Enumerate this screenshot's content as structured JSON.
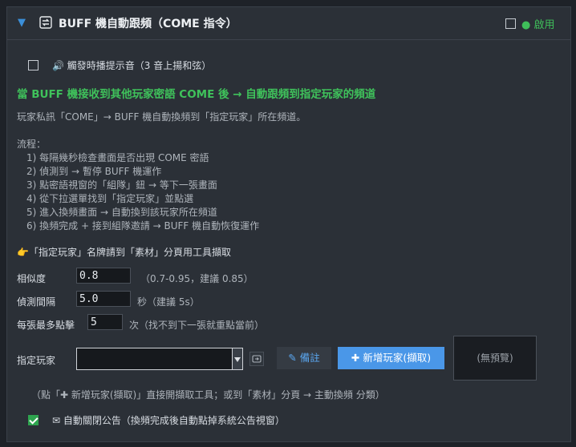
{
  "header": {
    "title": "BUFF 機自動跟頻（COME 指令）",
    "enable_label": "● 啟用"
  },
  "sound_option": {
    "label": "🔊 觸發時播提示音（3 音上揚和弦）",
    "checked": false
  },
  "headline": "當 BUFF 機接收到其他玩家密語 COME 後 → 自動跟頻到指定玩家的頻道",
  "description": "玩家私訊「COME」→ BUFF 機自動換頻到「指定玩家」所在頻道。",
  "flow": {
    "title": "流程：",
    "steps": [
      "1) 每隔幾秒檢查畫面是否出現 COME 密語",
      "2) 偵測到 → 暫停 BUFF 機運作",
      "3) 點密語視窗的「組隊」鈕 → 等下一張畫面",
      "4) 從下拉選單找到「指定玩家」並點選",
      "5) 進入換頻畫面 → 自動換到該玩家所在頻道",
      "6) 換頻完成 + 接到組隊邀請 → BUFF 機自動恢復運作"
    ]
  },
  "nameplate_hint": "👉「指定玩家」名牌請到「素材」分頁用工具擷取",
  "settings": {
    "similarity": {
      "label": "相似度",
      "value": "0.8",
      "hint": "（0.7-0.95，建議 0.85）"
    },
    "interval": {
      "label": "偵測間隔",
      "value": "5.0",
      "hint": "秒（建議 5s）"
    },
    "max_clicks": {
      "label": "每張最多點擊",
      "value": "5",
      "hint": "次（找不到下一張就重點當前）"
    }
  },
  "player": {
    "label": "指定玩家",
    "value": "",
    "note_button": "✎ 備註",
    "add_button": "✚ 新增玩家(擷取)",
    "preview_text": "(無預覽)"
  },
  "tool_hint": "（點「✚ 新增玩家(擷取)」直接開擷取工具；或到「素材」分頁 → 主動換頻 分類）",
  "auto_close": {
    "label": "✉ 自動關閉公告（換頻完成後自動點掉系統公告視窗）",
    "checked": true
  },
  "colors": {
    "accent_green": "#3fc25b",
    "accent_blue": "#4a97e8",
    "panel_bg": "#2b3037"
  }
}
